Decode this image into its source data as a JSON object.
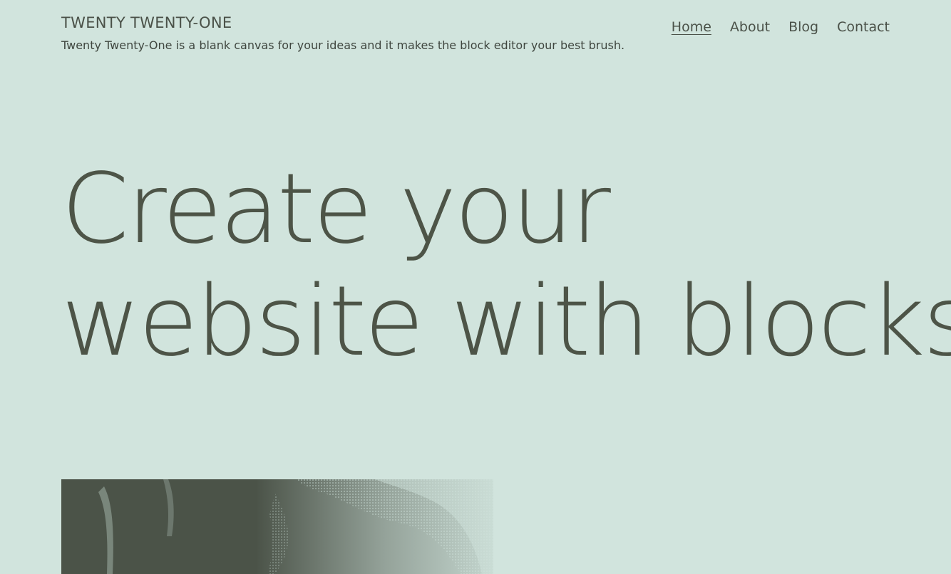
{
  "header": {
    "site_title": "TWENTY TWENTY-ONE",
    "site_description": "Twenty Twenty-One is a blank canvas for your ideas and it makes the block editor your best brush."
  },
  "nav": {
    "items": [
      {
        "label": "Home",
        "current": true
      },
      {
        "label": "About",
        "current": false
      },
      {
        "label": "Blog",
        "current": false
      },
      {
        "label": "Contact",
        "current": false
      }
    ]
  },
  "hero": {
    "line1": "Create your",
    "line2": "website with blocks"
  },
  "colors": {
    "background": "#d1e4dd",
    "text": "#4d5447",
    "image_dark": "#4b5348",
    "image_light": "#d1e4dd"
  }
}
